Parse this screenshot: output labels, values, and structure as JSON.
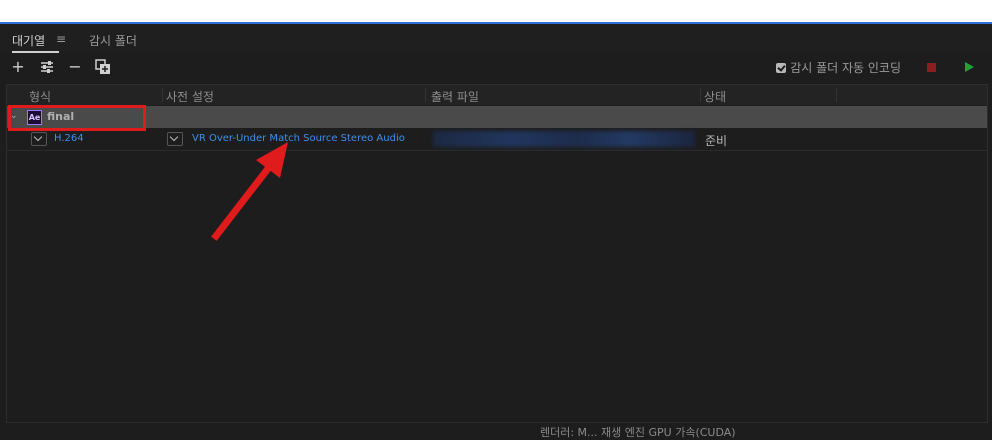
{
  "tabs": {
    "queue": "대기열",
    "watch": "감시 폴더",
    "menu_icon": "hamburger-menu-icon"
  },
  "toolbar": {
    "add": "+",
    "settings_icon": "preset-settings-icon",
    "remove": "−",
    "duplicate_icon": "duplicate-icon",
    "auto_encode_label": "감시 폴더 자동 인코딩",
    "auto_encode_checked": true
  },
  "columns": [
    "형식",
    "사전 설정",
    "출력 파일",
    "상태"
  ],
  "queue": {
    "group": {
      "icon_text": "Ae",
      "name": "final"
    },
    "items": [
      {
        "format": "H.264",
        "preset": "VR Over-Under Match Source Stereo Audio",
        "output": "",
        "status": "준비"
      }
    ]
  },
  "footer": {
    "text": "렌더러:  M...     재생 엔진 GPU 가속(CUDA)"
  },
  "colors": {
    "accent": "#2d6fd6",
    "link": "#3f8ee8",
    "stop": "#8b1e1e",
    "play": "#1fa23a",
    "highlight": "#e01b1b"
  }
}
